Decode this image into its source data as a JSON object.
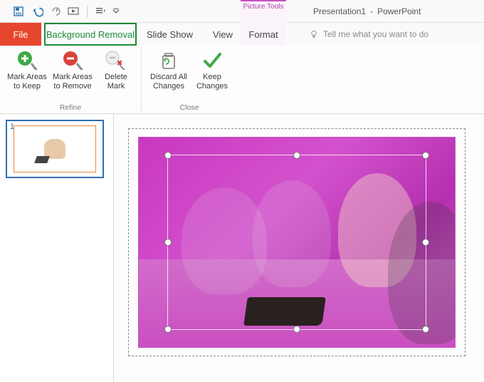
{
  "title": {
    "tool_tab": "Picture Tools",
    "doc": "Presentation1",
    "sep": "-",
    "app": "PowerPoint"
  },
  "tabs": {
    "file": "File",
    "bg_removal": "Background Removal",
    "slide_show": "Slide Show",
    "view": "View",
    "format": "Format"
  },
  "tellme": {
    "placeholder": "Tell me what you want to do"
  },
  "ribbon": {
    "refine": {
      "mark_keep_l1": "Mark Areas",
      "mark_keep_l2": "to Keep",
      "mark_remove_l1": "Mark Areas",
      "mark_remove_l2": "to Remove",
      "delete_mark_l1": "Delete",
      "delete_mark_l2": "Mark",
      "group_label": "Refine"
    },
    "close": {
      "discard_l1": "Discard All",
      "discard_l2": "Changes",
      "keep_l1": "Keep",
      "keep_l2": "Changes",
      "group_label": "Close"
    }
  },
  "thumbs": {
    "slide1_num": "1"
  }
}
